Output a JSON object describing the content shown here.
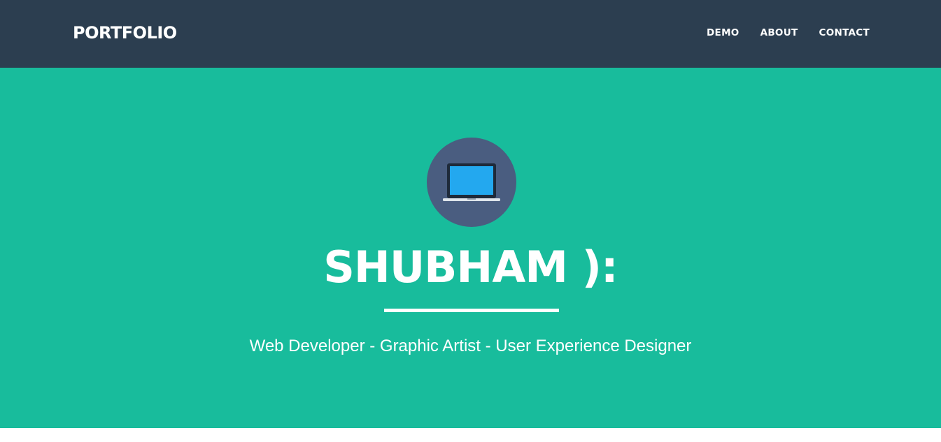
{
  "navbar": {
    "brand": "PORTFOLIO",
    "links": [
      "DEMO",
      "ABOUT",
      "CONTACT"
    ]
  },
  "hero": {
    "icon": "laptop-icon",
    "title": "SHUBHAM ):",
    "tagline": "Web Developer - Graphic Artist - User Experience Designer"
  },
  "colors": {
    "navbar_bg": "#2c3e50",
    "hero_bg": "#18bc9c",
    "avatar_bg": "#4a5d80",
    "screen": "#23a8ef"
  }
}
